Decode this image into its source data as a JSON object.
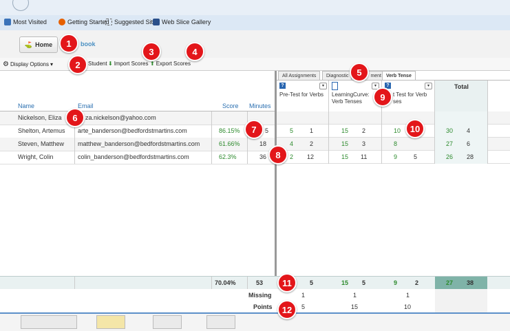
{
  "bookmarks": [
    {
      "label": "Most Visited",
      "icon": "most-visited-icon",
      "color": "#3b73b9"
    },
    {
      "label": "Getting Started",
      "icon": "firefox-icon",
      "color": "#e66000"
    },
    {
      "label": "Suggested Sites",
      "icon": "suggested-sites-icon",
      "color": "#ffffff"
    },
    {
      "label": "Web Slice Gallery",
      "icon": "web-slice-icon",
      "color": "#2a4f8a"
    }
  ],
  "nav": {
    "home_label": "Home",
    "book_label": "book"
  },
  "toolbar": {
    "display_options": "Display Options",
    "student": "Student",
    "import_scores": "Import Scores",
    "export_scores": "Export Scores"
  },
  "left_headers": {
    "name": "Name",
    "email": "Email",
    "score": "Score",
    "minutes": "Minutes"
  },
  "students": [
    {
      "name": "Nickelson, Eliza",
      "email": "za.nickelson@yahoo.com",
      "score": "",
      "minutes": ""
    },
    {
      "name": "Shelton, Artemus",
      "email": "arte_banderson@bedfordstmartins.com",
      "score": "86.15%",
      "minutes": "5"
    },
    {
      "name": "Steven, Matthew",
      "email": "matthew_banderson@bedfordstmartins.com",
      "score": "61.66%",
      "minutes": "18"
    },
    {
      "name": "Wright, Colin",
      "email": "colin_banderson@bedfordstmartins.com",
      "score": "62.3%",
      "minutes": "36"
    }
  ],
  "tabs": [
    "All Assignments",
    "Diagnostic",
    "ment",
    "Verb Tense"
  ],
  "assignments": [
    {
      "name_line1": "Pre-Test for Verbs",
      "name_line2": ""
    },
    {
      "name_line1": "LearningCurve:",
      "name_line2": "Verb Tenses"
    },
    {
      "name_line1": "t Test for Verb",
      "name_line2": "ses"
    }
  ],
  "total_header": "Total",
  "grades": [
    [
      "",
      "",
      "",
      "",
      "",
      "",
      "",
      ""
    ],
    [
      "5",
      "1",
      "15",
      "2",
      "10",
      "",
      "30",
      "4"
    ],
    [
      "4",
      "2",
      "15",
      "3",
      "8",
      "",
      "27",
      "6"
    ],
    [
      "2",
      "12",
      "15",
      "11",
      "9",
      "5",
      "26",
      "28"
    ]
  ],
  "averages": {
    "score": "70.04%",
    "minutes": "53",
    "grades": [
      "5",
      "15",
      "5",
      "9",
      "2",
      "27",
      "38"
    ]
  },
  "missing": {
    "label": "Missing",
    "values": [
      "1",
      "1",
      "1"
    ]
  },
  "points": {
    "label": "Points",
    "values": [
      "5",
      "15",
      "10"
    ]
  },
  "callouts": [
    "1",
    "2",
    "3",
    "4",
    "5",
    "6",
    "7",
    "8",
    "9",
    "10",
    "11",
    "12"
  ],
  "colors": {
    "accent": "#2a6fb0",
    "green": "#2e8b2e",
    "callout": "#e3161a",
    "total_highlight": "#7fb3a8"
  }
}
